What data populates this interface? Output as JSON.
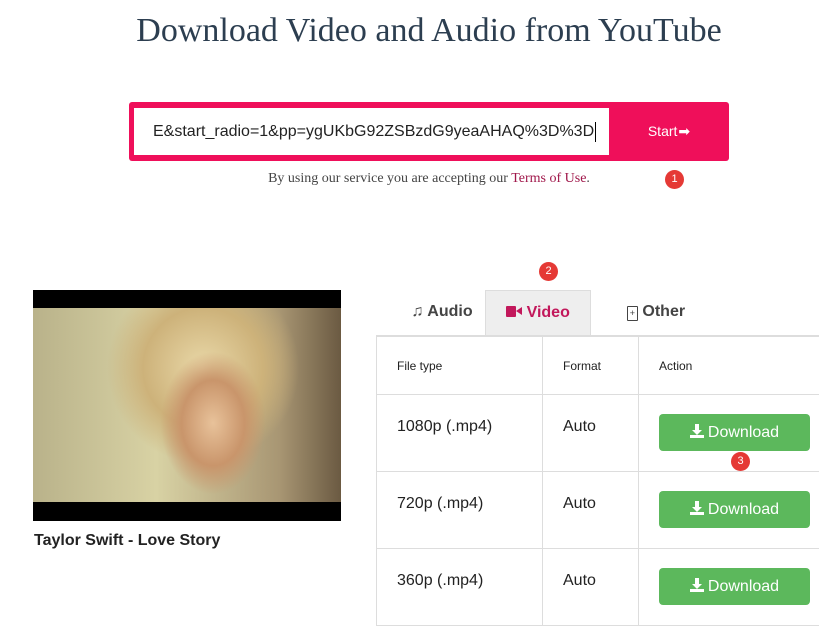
{
  "page": {
    "title": "Download Video and Audio from YouTube"
  },
  "search": {
    "value": "E&start_radio=1&pp=ygUKbG92ZSBzdG9yeaAHAQ%3D%3D",
    "start_label": "Start"
  },
  "terms": {
    "prefix": "By using our service you are accepting our",
    "link": "Terms of Use",
    "suffix": "."
  },
  "badges": [
    "1",
    "2",
    "3"
  ],
  "video": {
    "title": "Taylor Swift - Love Story"
  },
  "tabs": [
    {
      "label": "Audio",
      "icon": "music-icon"
    },
    {
      "label": "Video",
      "icon": "video-camera-icon"
    },
    {
      "label": "Other",
      "icon": "file-icon"
    }
  ],
  "active_tab": "Video",
  "table": {
    "headers": [
      "File type",
      "Format",
      "Action"
    ],
    "rows": [
      {
        "file_type": "1080p (.mp4)",
        "format": "Auto",
        "action": "Download"
      },
      {
        "file_type": "720p (.mp4)",
        "format": "Auto",
        "action": "Download"
      },
      {
        "file_type": "360p (.mp4)",
        "format": "Auto",
        "action": "Download"
      }
    ]
  },
  "colors": {
    "accent": "#ef0f5a",
    "download": "#5cb85c",
    "active_tab_text": "#c2185b",
    "badge": "#e53935"
  }
}
